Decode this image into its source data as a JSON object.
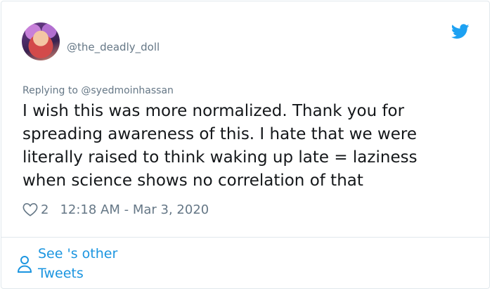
{
  "tweet": {
    "handle": "@the_deadly_doll",
    "replying_prefix": "Replying to",
    "replying_to": "@syedmoinhassan",
    "text": "I wish this was more normalized. Thank you for spreading awareness of this. I hate that we were literally raised to think waking up late = laziness when science shows no correlation of that",
    "likes": "2",
    "timestamp": "12:18 AM - Mar 3, 2020"
  },
  "footer": {
    "see_other_line1": "See 's other",
    "see_other_line2": "Tweets"
  },
  "icons": {
    "brand": "twitter-bird-icon",
    "like": "heart-icon",
    "profile": "person-icon"
  },
  "colors": {
    "brand_blue": "#1da1f2",
    "link_blue": "#1b95e0",
    "muted": "#657786",
    "text": "#14171a",
    "border": "#e1e8ed"
  }
}
